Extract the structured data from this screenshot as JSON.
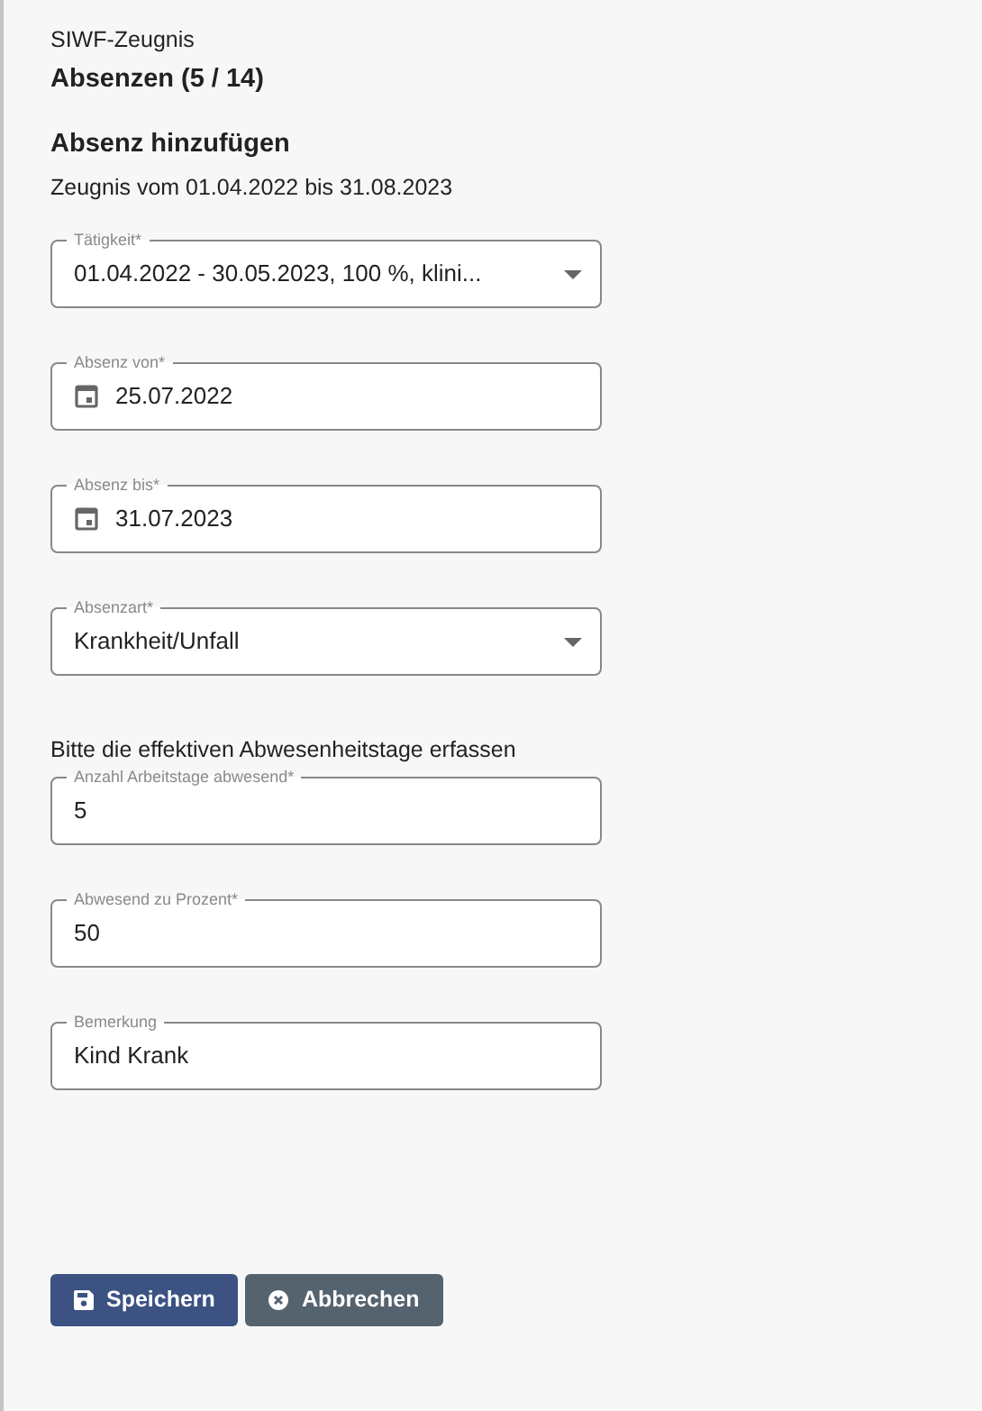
{
  "breadcrumb": "SIWF-Zeugnis",
  "title": "Absenzen (5 / 14)",
  "section_title": "Absenz hinzufügen",
  "subtitle": "Zeugnis vom 01.04.2022 bis 31.08.2023",
  "form_items": [
    {
      "kind": "select",
      "label": "Tätigkeit*",
      "value": "01.04.2022 - 30.05.2023, 100 %, klini..."
    },
    {
      "kind": "date",
      "label": "Absenz von*",
      "value": "25.07.2022"
    },
    {
      "kind": "date",
      "label": "Absenz bis*",
      "value": "31.07.2023"
    },
    {
      "kind": "select",
      "label": "Absenzart*",
      "value": "Krankheit/Unfall"
    },
    {
      "kind": "note",
      "text": "Bitte die effektiven Abwesenheitstage erfassen"
    },
    {
      "kind": "text",
      "label": "Anzahl Arbeitstage abwesend*",
      "value": "5"
    },
    {
      "kind": "text",
      "label": "Abwesend zu Prozent*",
      "value": "50"
    },
    {
      "kind": "text",
      "label": "Bemerkung",
      "value": "Kind Krank"
    }
  ],
  "buttons": [
    {
      "kind": "save",
      "label": "Speichern"
    },
    {
      "kind": "cancel",
      "label": "Abbrechen"
    }
  ]
}
